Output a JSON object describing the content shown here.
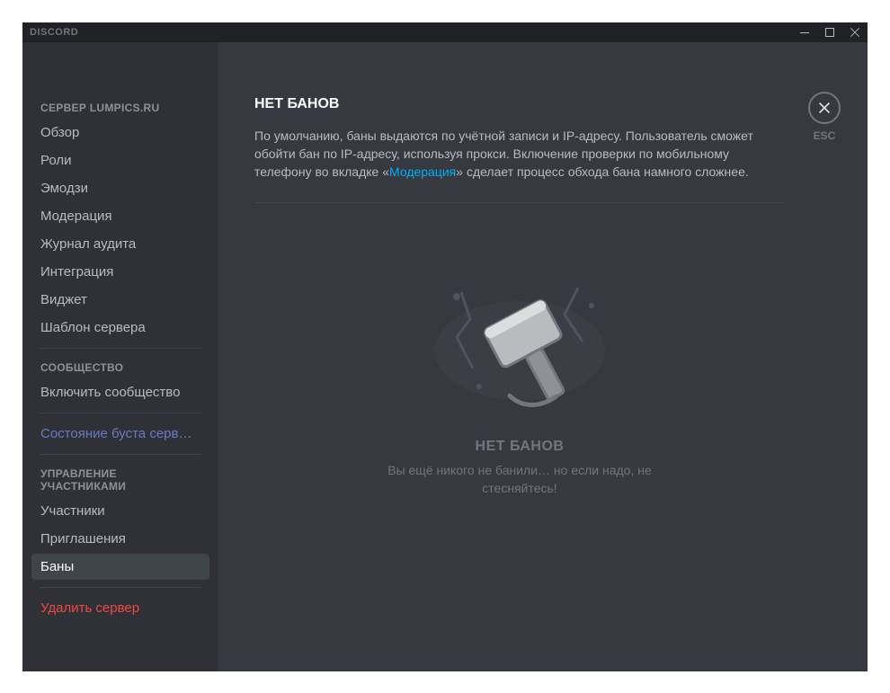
{
  "app": {
    "title": "DISCORD"
  },
  "close": {
    "esc_label": "ESC"
  },
  "sidebar": {
    "section_server": "СЕРВЕР LUMPICS.RU",
    "items_server": [
      "Обзор",
      "Роли",
      "Эмодзи",
      "Модерация",
      "Журнал аудита",
      "Интеграция",
      "Виджет",
      "Шаблон сервера"
    ],
    "section_community": "СООБЩЕСТВО",
    "items_community": [
      "Включить сообщество"
    ],
    "boost_status": "Состояние буста серв…",
    "section_members": "УПРАВЛЕНИЕ УЧАСТНИКАМИ",
    "items_members": [
      "Участники",
      "Приглашения",
      "Баны"
    ],
    "delete_server": "Удалить сервер"
  },
  "main": {
    "title": "НЕТ БАНОВ",
    "desc_before": "По умолчанию, баны выдаются по учётной записи и IP-адресу. Пользователь сможет обойти бан по IP-адресу, используя прокси. Включение проверки по мобильному телефону во вкладке «",
    "desc_link": "Модерация",
    "desc_after": "» сделает процесс обхода бана намного сложнее.",
    "empty_title": "НЕТ БАНОВ",
    "empty_subtitle": "Вы ещё никого не банили… но если надо, не стесняйтесь!"
  }
}
